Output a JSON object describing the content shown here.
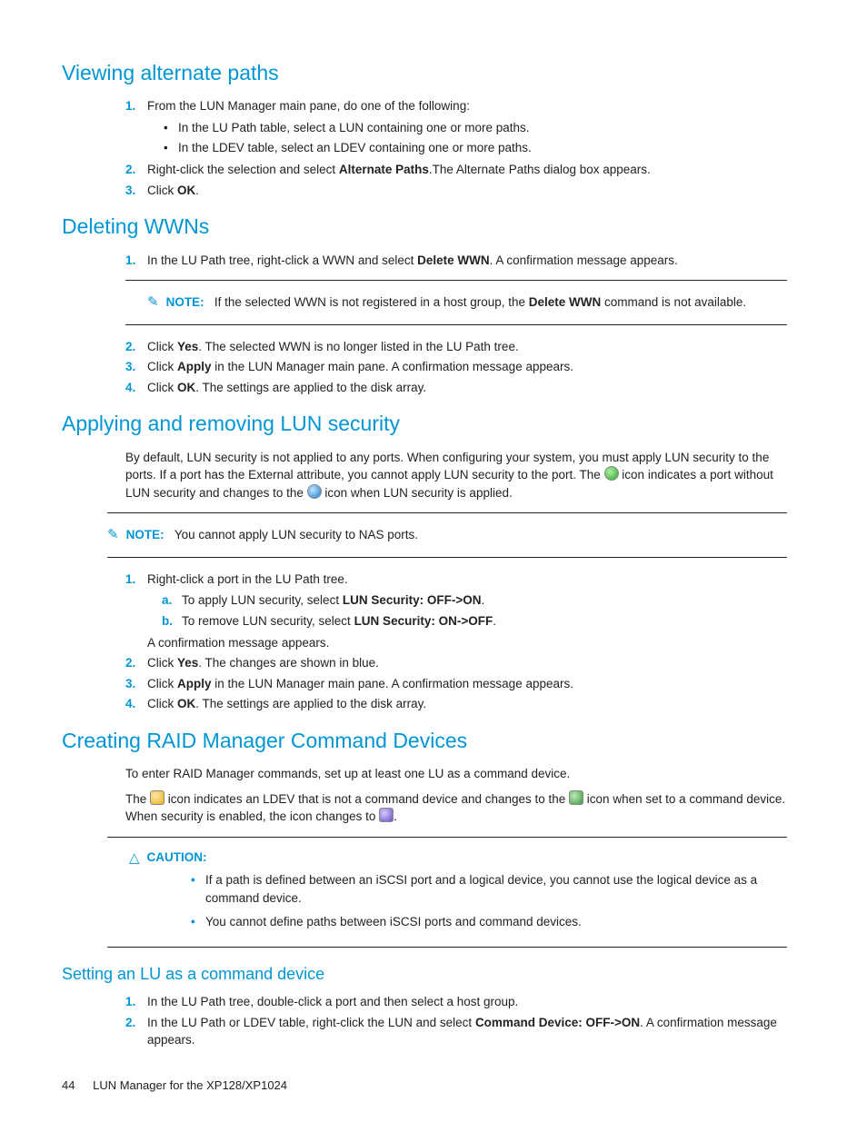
{
  "h": {
    "viewing": "Viewing alternate paths",
    "deleting": "Deleting WWNs",
    "applying": "Applying and removing LUN security",
    "creating": "Creating RAID Manager Command Devices",
    "setting": "Setting an LU as a command device"
  },
  "labels": {
    "note": "NOTE:",
    "caution": "CAUTION:"
  },
  "viewing": {
    "s1": "From the LUN Manager main pane, do one of the following:",
    "s1a": "In the LU Path table, select a LUN containing one or more paths.",
    "s1b": "In the LDEV table, select an LDEV containing one or more paths.",
    "s2a": "Right-click the selection and select ",
    "s2b": "Alternate Paths",
    "s2c": ".The Alternate Paths dialog box appears.",
    "s3a": "Click ",
    "s3b": "OK",
    "s3c": "."
  },
  "deleting": {
    "s1a": "In the LU Path tree, right-click a WWN and select ",
    "s1b": "Delete WWN",
    "s1c": ". A confirmation message appears.",
    "note_a": "If the selected WWN is not registered in a host group, the ",
    "note_b": "Delete WWN",
    "note_c": " command is not available.",
    "s2a": "Click ",
    "s2b": "Yes",
    "s2c": ". The selected WWN is no longer listed in the LU Path tree.",
    "s3a": "Click ",
    "s3b": "Apply",
    "s3c": " in the LUN Manager main pane. A confirmation message appears.",
    "s4a": "Click ",
    "s4b": "OK",
    "s4c": ". The settings are applied to the disk array."
  },
  "applying": {
    "p1a": "By default, LUN security is not applied to any ports. When configuring your system, you must apply LUN security to the ports. If a port has the External attribute, you cannot apply LUN security to the port. The ",
    "p1b": " icon indicates a port without LUN security and changes to the ",
    "p1c": " icon when LUN security is applied.",
    "note": "You cannot apply LUN security to NAS ports.",
    "s1": "Right-click a port in the LU Path tree.",
    "s1a_a": "To apply LUN security, select ",
    "s1a_b": "LUN Security: OFF->ON",
    "s1a_c": ".",
    "s1b_a": "To remove LUN security, select ",
    "s1b_b": "LUN Security: ON->OFF",
    "s1b_c": ".",
    "s1_tail": "A confirmation message appears.",
    "s2a": "Click ",
    "s2b": "Yes",
    "s2c": ". The changes are shown in blue.",
    "s3a": "Click ",
    "s3b": "Apply",
    "s3c": " in the LUN Manager main pane. A confirmation message appears.",
    "s4a": "Click ",
    "s4b": "OK",
    "s4c": ". The settings are applied to the disk array."
  },
  "creating": {
    "p1": "To enter RAID Manager commands, set up at least one LU as a command device.",
    "p2a": "The ",
    "p2b": " icon indicates an LDEV that is not a command device and changes to the ",
    "p2c": " icon when set to a command device. When security is enabled, the icon changes to ",
    "p2d": ".",
    "c1": "If a path is defined between an iSCSI port and a logical device, you cannot use the logical device as a command device.",
    "c2": "You cannot define paths between iSCSI ports and command devices."
  },
  "setting": {
    "s1": "In the LU Path tree, double-click a port and then select a host group.",
    "s2a": "In the LU Path or LDEV table, right-click the LUN and select ",
    "s2b": "Command Device: OFF->ON",
    "s2c": ". A confirmation message appears."
  },
  "footer": {
    "page": "44",
    "title": "LUN Manager for the XP128/XP1024"
  }
}
